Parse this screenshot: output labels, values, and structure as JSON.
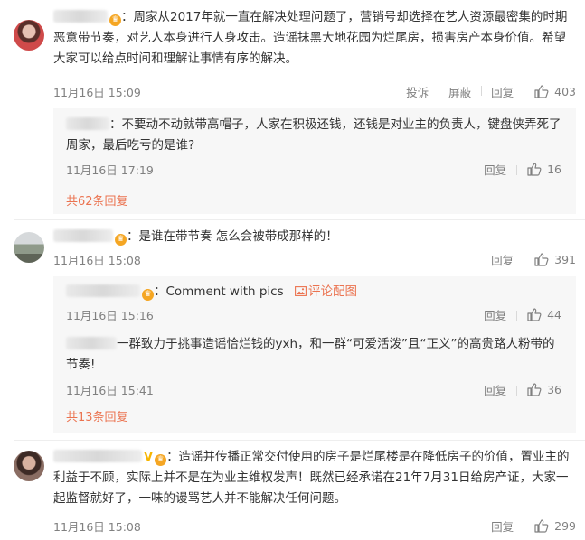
{
  "comments": [
    {
      "text": "：周家从2017年就一直在解决处理问题了，营销号却选择在艺人资源最密集的时期恶意带节奏，对艺人本身进行人身攻击。造谣抹黑大地花园为烂尾房，损害房产本身价值。希望大家可以给点时间和理解让事情有序的解决。",
      "time": "11月16日 15:09",
      "report": "投诉",
      "block": "屏蔽",
      "reply": "回复",
      "likes": "403",
      "replies": [
        {
          "text": "：不要动不动就带高帽子，人家在积极还钱，还钱是对业主的负责人，键盘侠弄死了周家，最后吃亏的是谁?",
          "time": "11月16日 17:19",
          "reply": "回复",
          "likes": "16"
        }
      ],
      "more": "共62条回复"
    },
    {
      "text": "：是谁在带节奏 怎么会被带成那样的！",
      "time": "11月16日 15:08",
      "reply": "回复",
      "likes": "391",
      "replies": [
        {
          "text": "：Comment with pics",
          "pic_link": "评论配图",
          "time": "11月16日 15:16",
          "reply": "回复",
          "likes": "44"
        },
        {
          "text": "一群致力于挑事造谣恰烂钱的yxh，和一群“可爱活泼”且“正义”的高贵路人粉带的节奏!",
          "time": "11月16日 15:41",
          "reply": "回复",
          "likes": "36"
        }
      ],
      "more": "共13条回复"
    },
    {
      "badge": "V",
      "text": "：造谣并传播正常交付使用的房子是烂尾楼是在降低房子的价值，置业主的利益于不顾，实际上并不是在为业主维权发声！既然已经承诺在21年7月31日给房产证，大家一起监督就好了，一味的谩骂艺人并不能解决任何问题。",
      "time": "11月16日 15:08",
      "reply": "回复",
      "likes": "299"
    }
  ],
  "icons": {
    "like": "thumbs-up-icon",
    "pic": "image-icon",
    "vip": "vip-badge-icon"
  },
  "colors": {
    "accent": "#eb7350",
    "muted": "#808080",
    "reply_bg": "#f7f7f7"
  }
}
